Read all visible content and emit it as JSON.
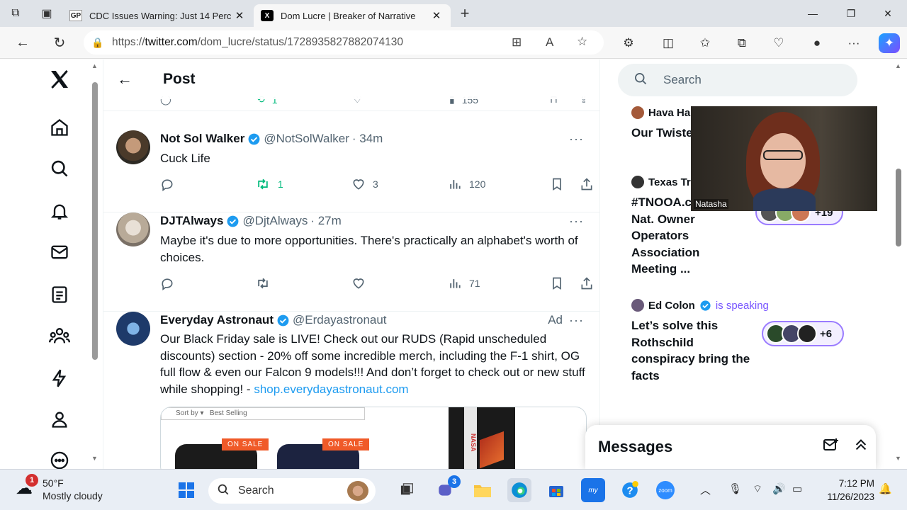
{
  "browser": {
    "tabs": [
      {
        "favicon": "GP",
        "title": "CDC Issues Warning: Just 14 Perc",
        "close": "✕"
      },
      {
        "favicon": "X",
        "title": "Dom Lucre | Breaker of Narrative",
        "close": "✕"
      }
    ],
    "new_tab": "+",
    "url_prefix": "https://",
    "url_host": "twitter.com",
    "url_path": "/dom_lucre/status/1728935827882074130"
  },
  "header": {
    "title": "Post",
    "back": "←"
  },
  "top_actions": {
    "retweets": "1",
    "views": "155"
  },
  "tweets": [
    {
      "name": "Not Sol Walker",
      "handle": "@NotSolWalker",
      "time": "· 34m",
      "text": "Cuck Life",
      "replies": "",
      "retweets": "1",
      "likes": "3",
      "views": "120"
    },
    {
      "name": "DJTAlways",
      "handle": "@DjtAlways",
      "time": "· 27m",
      "text": "Maybe it's due to more opportunities. There's practically an alphabet's worth of choices.",
      "replies": "",
      "retweets": "",
      "likes": "",
      "views": "71"
    },
    {
      "name": "Everyday Astronaut",
      "handle": "@Erdayastronaut",
      "ad": "Ad",
      "text": "Our Black Friday sale is LIVE! Check out our RUDS (Rapid unscheduled discounts) section - 20% off some incredible merch, including the F-1 shirt, OG full flow & even our Falcon 9 models!!! And don’t forget to check out or new stuff while shopping! - ",
      "link": "shop.everydayastronaut.com",
      "media": {
        "sort_label": "Sort by",
        "sort_value": "Best Selling",
        "tag1": "ON SALE",
        "tag2": "ON SALE",
        "rocket_text": "NASA"
      }
    }
  ],
  "more": "···",
  "sidebar": {
    "search_placeholder": "Search",
    "spaces": [
      {
        "host": "Hava Ha",
        "title": "Our Twiste"
      },
      {
        "host": "Texas Tr",
        "title": "#TNOOA.c Nat. Owner Operators Association Meeting ...",
        "listeners": "+19"
      },
      {
        "host": "Ed Colon",
        "status": "is speaking",
        "title": "Let’s solve this Rothschild conspiracy bring the facts",
        "listeners": "+6"
      }
    ],
    "video_name": "Natasha"
  },
  "messages": {
    "title": "Messages"
  },
  "taskbar": {
    "weather_badge": "1",
    "temperature": "50°F",
    "condition": "Mostly cloudy",
    "search": "Search",
    "teams_badge": "3",
    "zoom_label": "zoom",
    "time": "7:12 PM",
    "date": "11/26/2023"
  },
  "colors": {
    "accent": "#1d9bf0",
    "retweet": "#00ba7c",
    "spaces": "#7856ff",
    "ad_tag": "#ff5722"
  }
}
